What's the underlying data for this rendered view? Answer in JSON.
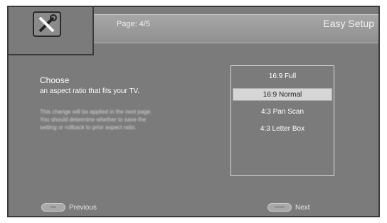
{
  "header": {
    "page": "Page: 4/5",
    "title": "Easy Setup",
    "icon": "wrench-screwdriver-icon"
  },
  "content": {
    "heading": "Choose",
    "subheading": "an aspect ratio that fits your TV.",
    "description_lines": [
      "This change will be applied in the next page.",
      "You should determine whether to save the",
      "setting or rollback to prior aspect ratio."
    ]
  },
  "options": {
    "items": [
      "16:9 Full",
      "16:9 Normal",
      "4:3 Pan Scan",
      "4:3 Letter Box"
    ],
    "selected": "16:9 Normal"
  },
  "footer": {
    "previous_label": "Previous",
    "previous_key": "RED",
    "next_label": "Next",
    "next_key": "ENTER"
  }
}
